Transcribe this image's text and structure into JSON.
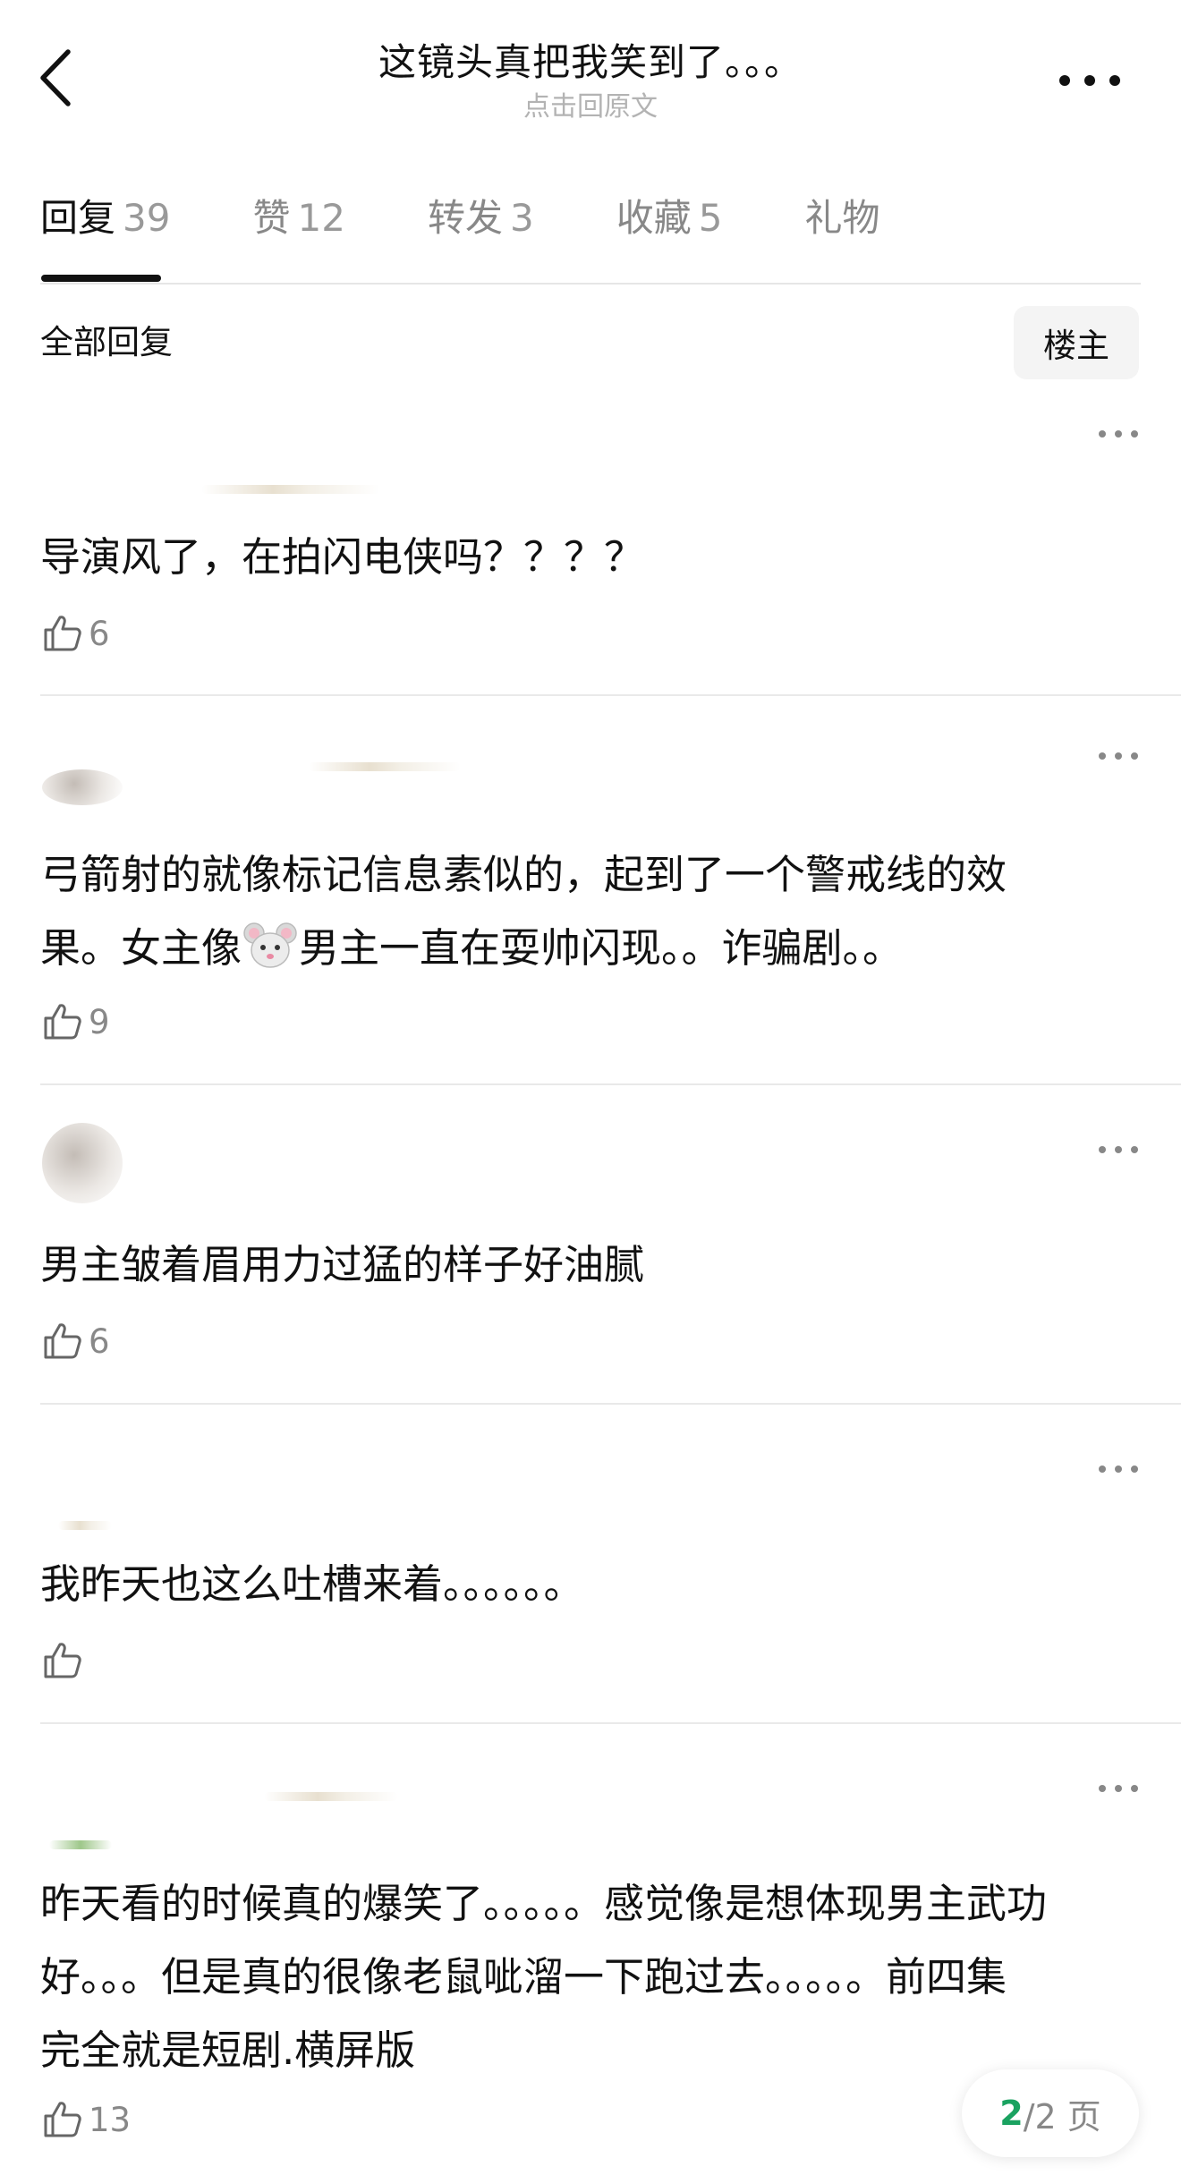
{
  "header": {
    "title": "这镜头真把我笑到了。。。",
    "subtitle": "点击回原文",
    "back_icon": "chevron-left-icon",
    "more_icon": "more-horizontal-icon"
  },
  "tabs": [
    {
      "label": "回复",
      "count": "39",
      "active": true
    },
    {
      "label": "赞",
      "count": "12",
      "active": false
    },
    {
      "label": "转发",
      "count": "3",
      "active": false
    },
    {
      "label": "收藏",
      "count": "5",
      "active": false
    },
    {
      "label": "礼物",
      "count": "",
      "active": false
    }
  ],
  "section": {
    "title": "全部回复",
    "filter_button": "楼主"
  },
  "comments": [
    {
      "text": "导演风了，在拍闪电侠吗？？？？",
      "likes": "6"
    },
    {
      "text_line1": "弓箭射的就像标记信息素似的，起到了一个警戒线的效",
      "text_before_emoji": "果。女主像",
      "emoji": "mouse-face-emoji",
      "text_after_emoji": "男主一直在耍帅闪现。。诈骗剧。。",
      "likes": "9"
    },
    {
      "text": "男主皱着眉用力过猛的样子好油腻",
      "likes": "6"
    },
    {
      "text": "我昨天也这么吐槽来着。。。。。。",
      "likes": ""
    },
    {
      "text_line1": "昨天看的时候真的爆笑了。。。。。感觉像是想体现男主武功",
      "text_line2": "好。。。但是真的很像老鼠呲溜一下跑过去。。。。。前四集",
      "text_line3": "完全就是短剧.横屏版",
      "likes": "13"
    }
  ],
  "pagination": {
    "current": "2",
    "total_text": "/2 页"
  },
  "colors": {
    "accent_green": "#1aa260",
    "muted_text": "#888888",
    "divider": "#e9e9e9"
  }
}
